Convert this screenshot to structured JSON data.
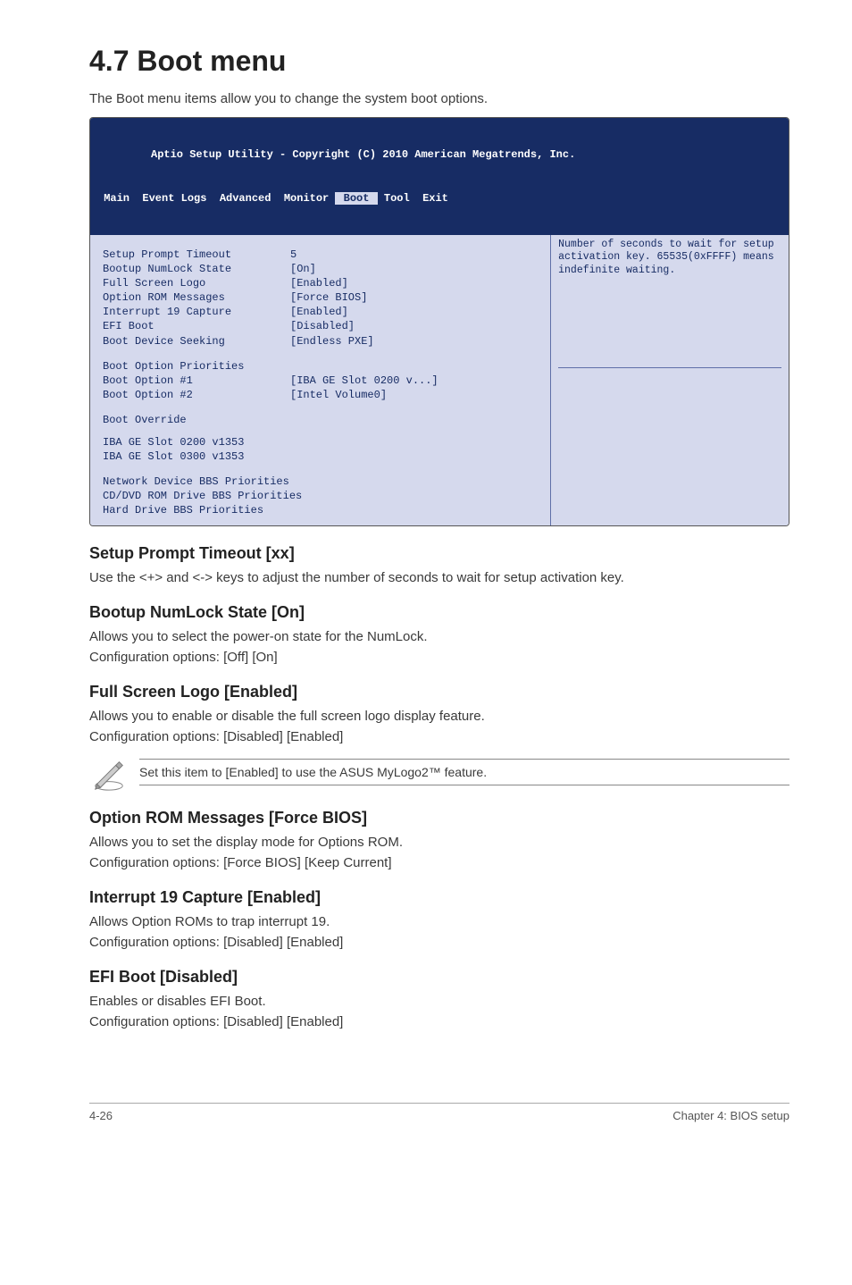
{
  "heading": "4.7    Boot menu",
  "intro": "The Boot menu items allow you to change the system boot options.",
  "bios": {
    "title": "Aptio Setup Utility - Copyright (C) 2010 American Megatrends, Inc.",
    "tabs": " Main  Event Logs  Advanced  Monitor ",
    "tab_active": " Boot ",
    "tabs_after": " Tool  Exit",
    "left_items": [
      {
        "label": "Setup Prompt Timeout",
        "value": "5"
      },
      {
        "label": "Bootup NumLock State",
        "value": "[On]"
      },
      {
        "label": "Full Screen Logo",
        "value": "[Enabled]"
      },
      {
        "label": "Option ROM Messages",
        "value": "[Force BIOS]"
      },
      {
        "label": "Interrupt 19 Capture",
        "value": "[Enabled]"
      },
      {
        "label": "EFI Boot",
        "value": "[Disabled]"
      },
      {
        "label": "Boot Device Seeking",
        "value": "[Endless PXE]"
      }
    ],
    "prio_header": "Boot Option Priorities",
    "prio_items": [
      {
        "label": "Boot Option #1",
        "value": "[IBA GE Slot 0200 v...]"
      },
      {
        "label": "Boot Option #2",
        "value": "[Intel Volume0]"
      }
    ],
    "override_header": "Boot Override",
    "override_items": [
      "IBA GE Slot 0200 v1353",
      "IBA GE Slot 0300 v1353"
    ],
    "extra_items": [
      "Network Device BBS Priorities",
      "CD/DVD ROM Drive BBS Priorities",
      "Hard Drive BBS Priorities"
    ],
    "help": "Number of seconds to wait for setup activation key. 65535(0xFFFF) means indefinite waiting."
  },
  "sections": [
    {
      "title": "Setup Prompt Timeout [xx]",
      "paras": [
        "Use the <+> and <-> keys to adjust the number of seconds to wait for setup activation key."
      ]
    },
    {
      "title": "Bootup NumLock State [On]",
      "paras": [
        "Allows you to select the power-on state for the NumLock.",
        "Configuration options: [Off] [On]"
      ]
    },
    {
      "title": "Full Screen Logo [Enabled]",
      "paras": [
        "Allows you to enable or disable the full screen logo display feature.",
        "Configuration options: [Disabled] [Enabled]"
      ]
    }
  ],
  "note": "Set this item to [Enabled] to use the ASUS MyLogo2™ feature.",
  "sections2": [
    {
      "title": "Option ROM Messages [Force BIOS]",
      "paras": [
        "Allows you to set the display mode for Options ROM.",
        "Configuration options: [Force BIOS] [Keep Current]"
      ]
    },
    {
      "title": "Interrupt 19 Capture [Enabled]",
      "paras": [
        "Allows Option ROMs to trap interrupt 19.",
        "Configuration options: [Disabled] [Enabled]"
      ]
    },
    {
      "title": "EFI Boot [Disabled]",
      "paras": [
        "Enables or disables EFI Boot.",
        "Configuration options: [Disabled] [Enabled]"
      ]
    }
  ],
  "footer": {
    "left": "4-26",
    "right": "Chapter 4: BIOS setup"
  }
}
